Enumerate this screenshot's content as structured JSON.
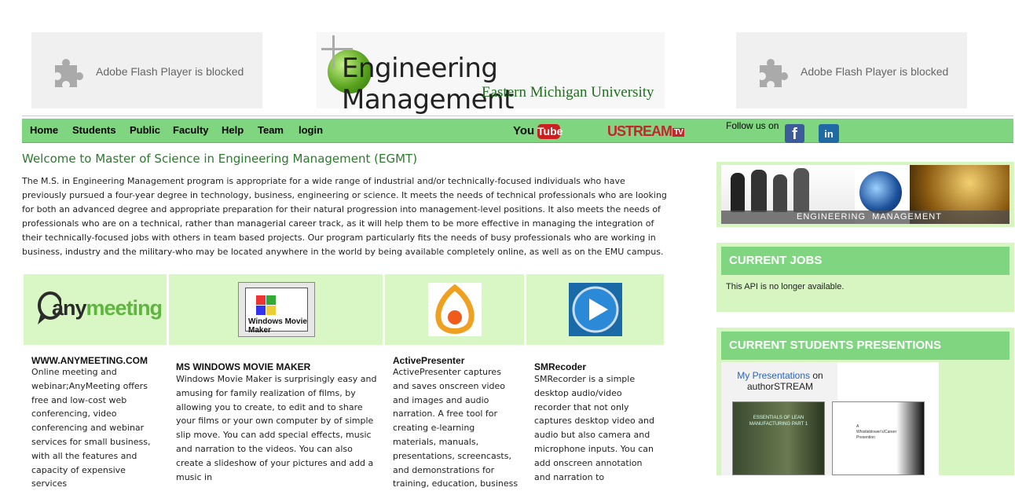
{
  "flash": {
    "left_text": "Adobe Flash Player is blocked",
    "right_text": "Adobe Flash Player is blocked"
  },
  "logo": {
    "title": "Engineering Management",
    "subtitle": "Eastern Michigan University"
  },
  "nav": {
    "items": [
      "Home",
      "Students",
      "Public",
      "Faculty",
      "Help",
      "Team",
      "login"
    ],
    "youtube_you": "You",
    "youtube_tube": "Tube",
    "ustream": "USTREAM",
    "ustream_tv": "TV",
    "follow": "Follow us on",
    "facebook": "f",
    "linkedin": "in"
  },
  "main": {
    "welcome": "Welcome to Master of Science in Engineering Management (EGMT)",
    "intro": "The M.S. in Engineering Management program is appropriate for a wide range of industrial and/or technically-focused individuals who have previously pursued a four-year degree in technology, business, engineering or science. It meets the needs of technical professionals who are looking for both an advanced degree and appropriate preparation for their natural progression into management-level positions. It also meets the needs of professionals who are on a technical, rather than managerial career track, as it will help them to be more effective in managing the integration of their technically-focused jobs with others in team based projects. Our program particularly fits the needs of busy professionals who are working in business, industry and the military-who may be located anywhere in the world by being available completely online, as well as on the EMU campus.",
    "tools": [
      {
        "logo_text": "anymeeting",
        "title": "WWW.ANYMEETING.COM",
        "body": "Online meeting and webinar;AnyMeeting offers free and low-cost web conferencing, video conferencing and webinar services for small business, with all the features and capacity of expensive services"
      },
      {
        "logo_text": "Windows Movie Maker",
        "title": "MS WINDOWS MOVIE MAKER",
        "body": "Windows Movie Maker is surprisingly easy and amusing for family realization of films, by allowing you to create, to edit and to share your films or your own computer by of simple slip move. You can add special effects, music and narration to the videos. You can also create a slideshow of your pictures and add a music in"
      },
      {
        "logo_text": "",
        "title": "ActivePresenter",
        "body": "ActivePresenter captures and saves onscreen video and images and audio narration. A free tool for creating e-learning materials, manuals, presentations, screencasts, and demonstrations for training, education, business"
      },
      {
        "logo_text": "",
        "title": "SMRecoder",
        "body": "SMRecorder is a simple desktop audio/video recorder that not only captures desktop video and audio but also camera and microphone inputs. You can add onscreen annotation and narration to"
      }
    ]
  },
  "sidebar": {
    "banner_text": "ENGINEERING  MANAGEMENT",
    "jobs_header": "CURRENT JOBS",
    "jobs_text": "This API is no longer available.",
    "pres_header": "CURRENT STUDENTS PRESENTIONS",
    "pres_link": "My Presentations",
    "pres_on": " on",
    "pres_site": "authorSTREAM",
    "thumb1_text": "ESSENTIALS OF LEAN MANUFACTURING PART 1",
    "thumb2_text": "A Whistleblower's/Career Presention"
  }
}
